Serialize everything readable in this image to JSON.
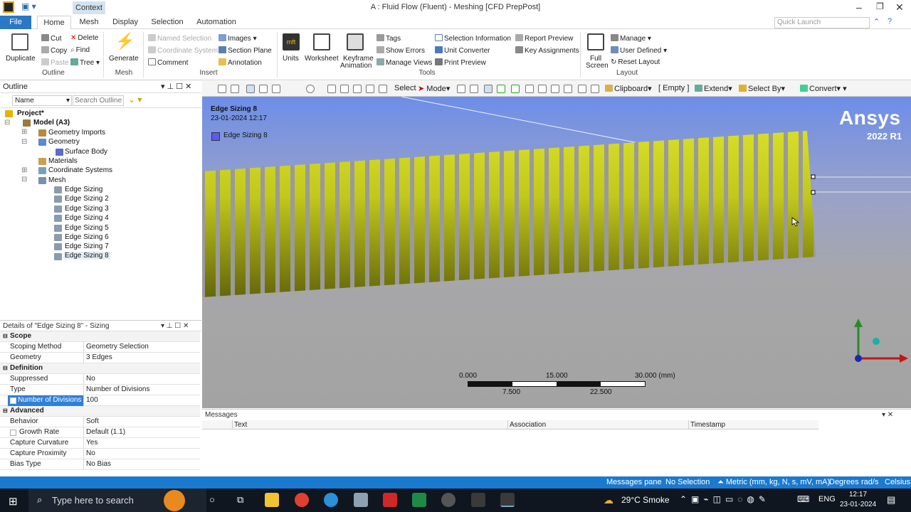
{
  "window": {
    "context_label": "Context",
    "title": "A : Fluid Flow (Fluent) - Meshing [CFD PrepPost]"
  },
  "tabs": [
    {
      "label": "File"
    },
    {
      "label": "Home"
    },
    {
      "label": "Mesh"
    },
    {
      "label": "Display"
    },
    {
      "label": "Selection"
    },
    {
      "label": "Automation"
    }
  ],
  "quick_launch": {
    "placeholder": "Quick Launch"
  },
  "ribbon": {
    "outline": {
      "group": "Outline",
      "duplicate": "Duplicate",
      "cut": "Cut",
      "copy": "Copy",
      "paste": "Paste",
      "delete": "Delete",
      "find": "Find",
      "tree": "Tree"
    },
    "mesh": {
      "group": "Mesh",
      "generate": "Generate"
    },
    "insert": {
      "group": "Insert",
      "named_selection": "Named Selection",
      "coordinate_system": "Coordinate System",
      "comment": "Comment",
      "images": "Images",
      "section_plane": "Section Plane",
      "annotation": "Annotation"
    },
    "tools": {
      "group": "Tools",
      "units": "Units",
      "worksheet": "Worksheet",
      "keyframe_1": "Keyframe",
      "keyframe_2": "Animation",
      "tags": "Tags",
      "show_errors": "Show Errors",
      "manage_views": "Manage Views",
      "selection_information": "Selection Information",
      "unit_converter": "Unit Converter",
      "print_preview": "Print Preview",
      "report_preview": "Report Preview",
      "key_assignments": "Key Assignments"
    },
    "layout": {
      "group": "Layout",
      "full_1": "Full",
      "full_2": "Screen",
      "manage": "Manage",
      "user_defined": "User Defined",
      "reset_layout": "Reset Layout"
    }
  },
  "outline": {
    "title": "Outline",
    "name_col": "Name",
    "search_placeholder": "Search Outline",
    "tree": [
      {
        "label": "Project*"
      },
      {
        "label": "Model (A3)"
      },
      {
        "label": "Geometry Imports"
      },
      {
        "label": "Geometry"
      },
      {
        "label": "Surface Body"
      },
      {
        "label": "Materials"
      },
      {
        "label": "Coordinate Systems"
      },
      {
        "label": "Mesh"
      },
      {
        "label": "Edge Sizing"
      },
      {
        "label": "Edge Sizing 2"
      },
      {
        "label": "Edge Sizing 3"
      },
      {
        "label": "Edge Sizing 4"
      },
      {
        "label": "Edge Sizing 5"
      },
      {
        "label": "Edge Sizing 6"
      },
      {
        "label": "Edge Sizing 7"
      },
      {
        "label": "Edge Sizing 8"
      }
    ]
  },
  "details": {
    "title": "Details of \"Edge Sizing 8\" - Sizing",
    "rows": [
      {
        "k": "Scope",
        "v": ""
      },
      {
        "k": "Scoping Method",
        "v": "Geometry Selection"
      },
      {
        "k": "Geometry",
        "v": "3 Edges"
      },
      {
        "k": "Definition",
        "v": ""
      },
      {
        "k": "Suppressed",
        "v": "No"
      },
      {
        "k": "Type",
        "v": "Number of Divisions"
      },
      {
        "k": "Number of Divisions",
        "v": "100"
      },
      {
        "k": "Advanced",
        "v": ""
      },
      {
        "k": "Behavior",
        "v": "Soft"
      },
      {
        "k": "Growth Rate",
        "v": "Default (1.1)"
      },
      {
        "k": "Capture Curvature",
        "v": "Yes"
      },
      {
        "k": "Capture Proximity",
        "v": "No"
      },
      {
        "k": "Bias Type",
        "v": "No Bias"
      }
    ]
  },
  "graphics_toolbar": {
    "select": "Select",
    "mode": "Mode",
    "clipboard": "Clipboard",
    "empty": "[ Empty ]",
    "extend": "Extend",
    "select_by": "Select By",
    "convert": "Convert"
  },
  "viewport": {
    "annotation_title": "Edge Sizing 8",
    "annotation_date": "23-01-2024 12:17",
    "legend_label": "Edge Sizing 8",
    "legend_color": "#5b5bf0",
    "brand": "Ansys",
    "version": "2022 R1",
    "scale": {
      "t0": "0.000",
      "t1": "15.000",
      "t2": "30.000 (mm)",
      "b1": "7.500",
      "b2": "22.500"
    }
  },
  "messages": {
    "title": "Messages",
    "cols": [
      "Text",
      "Association",
      "Timestamp"
    ]
  },
  "status": {
    "messages_pane": "Messages pane",
    "selection": "No Selection",
    "units": "Metric (mm, kg, N, s, mV, mA)",
    "angle": "Degrees",
    "rate": "rad/s",
    "temp": "Celsius"
  },
  "taskbar": {
    "search": "Type here to search",
    "weather": "29°C Smoke",
    "lang": "ENG",
    "time": "12:17",
    "date": "23-01-2024"
  }
}
